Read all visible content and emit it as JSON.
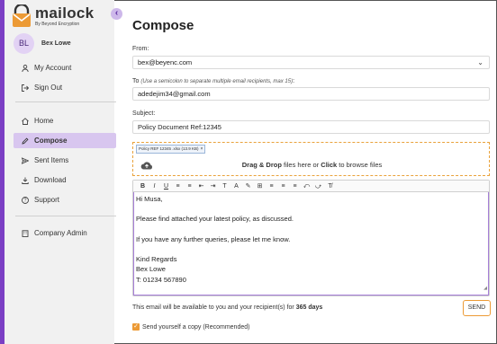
{
  "brand": {
    "name": "mailock",
    "tagline": "By Beyond Encryption",
    "accent": "#7b3fc4",
    "highlight": "#ec9a35"
  },
  "sidebar": {
    "collapse_icon": "‹",
    "user": {
      "initials": "BL",
      "name": "Bex Lowe"
    },
    "account_items": [
      {
        "label": "My Account",
        "icon": "user-icon"
      },
      {
        "label": "Sign Out",
        "icon": "sign-out-icon"
      }
    ],
    "items": [
      {
        "label": "Home",
        "icon": "home-icon"
      },
      {
        "label": "Compose",
        "icon": "pencil-icon",
        "active": true
      },
      {
        "label": "Sent Items",
        "icon": "send-icon"
      },
      {
        "label": "Download",
        "icon": "download-icon"
      },
      {
        "label": "Support",
        "icon": "help-icon"
      }
    ],
    "admin": {
      "label": "Company Admin",
      "icon": "building-icon"
    }
  },
  "compose": {
    "title": "Compose",
    "from_label": "From:",
    "from_value": "bex@beyenc.com",
    "to_label": "To",
    "to_hint": "(Use a semicolon to separate multiple email recipients, max 15)",
    "to_label_suffix": ":",
    "to_value": "adedejim34@gmail.com",
    "subject_label": "Subject:",
    "subject_value": "Policy Document Ref:12345",
    "attachment": {
      "name": "Policy REF 12345 .xlsx (13.9 KB)",
      "remove": "×"
    },
    "dropzone": {
      "bold1": "Drag & Drop",
      "text1": " files here or ",
      "bold2": "Click",
      "text2": " to browse files"
    },
    "toolbar": [
      "B",
      "I",
      "U",
      "≡",
      "≡",
      "⇤",
      "⇥",
      "T",
      "A",
      "✎",
      "⊞",
      "≡",
      "≡",
      "≡",
      "⤺",
      "⤻",
      "T̸"
    ],
    "body_lines": [
      "Hi Musa,",
      "",
      "Please find attached your latest policy, as discussed.",
      "",
      "If you have any further queries, please let me know.",
      "",
      "Kind Regards",
      "Bex Lowe",
      "T: 01234 567890"
    ],
    "availability_prefix": "This email will be available to you and your recipient(s) for ",
    "availability_days": "365 days",
    "send_label": "SEND",
    "copy_label": "Send yourself a copy (Recommended)",
    "copy_checked": true
  }
}
